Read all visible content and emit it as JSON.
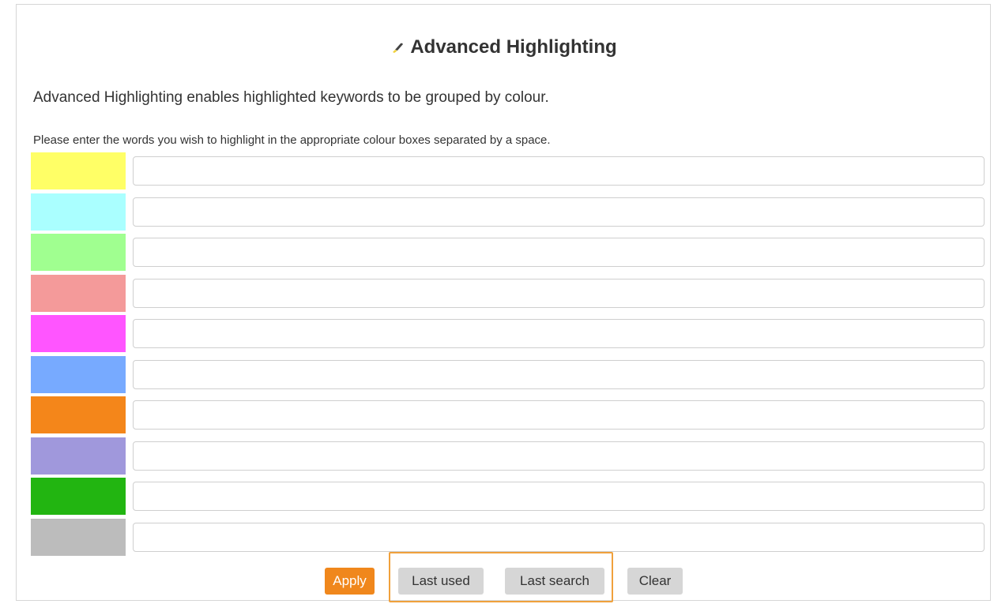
{
  "dialog": {
    "title": "Advanced Highlighting",
    "description": "Advanced Highlighting enables highlighted keywords to be grouped by colour.",
    "instruction": "Please enter the words you wish to highlight in the appropriate colour boxes separated by a space."
  },
  "highlight_rows": [
    {
      "color": "#ffff66",
      "value": ""
    },
    {
      "color": "#aaffff",
      "value": ""
    },
    {
      "color": "#a0ff90",
      "value": ""
    },
    {
      "color": "#f49a9a",
      "value": ""
    },
    {
      "color": "#ff55ff",
      "value": ""
    },
    {
      "color": "#77aaff",
      "value": ""
    },
    {
      "color": "#f4861a",
      "value": ""
    },
    {
      "color": "#a098dc",
      "value": ""
    },
    {
      "color": "#22b511",
      "value": ""
    },
    {
      "color": "#bcbcbc",
      "value": ""
    }
  ],
  "buttons": {
    "apply": "Apply",
    "last_used": "Last used",
    "last_search": "Last search",
    "clear": "Clear"
  },
  "colors": {
    "accent": "#f0871c",
    "focus_outline": "#f0a13c"
  },
  "icons": {
    "title_icon": "highlighter-pen-icon"
  }
}
